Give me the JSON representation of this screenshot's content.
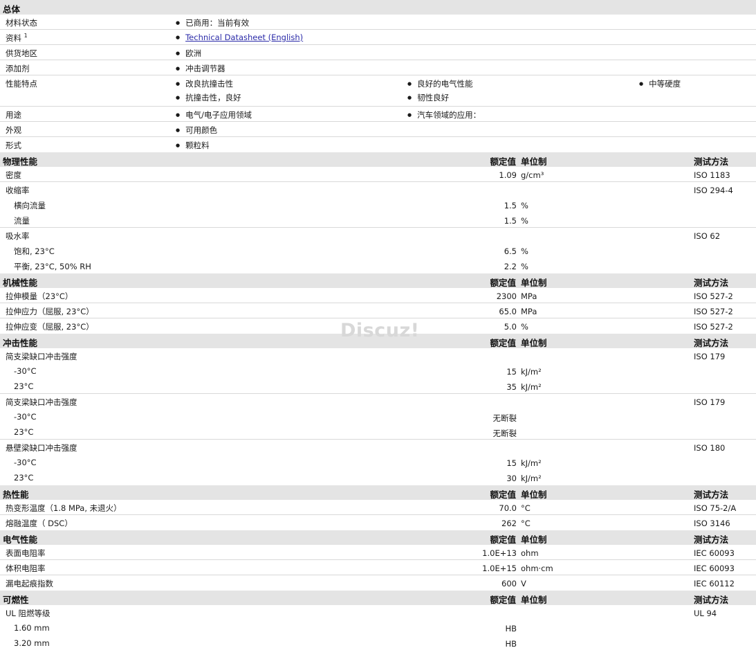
{
  "overview": {
    "title": "总体",
    "status_label": "材料状态",
    "status_value": "已商用：当前有效",
    "docs_label": "资料",
    "docs_sup": "1",
    "docs_link": "Technical Datasheet (English)",
    "region_label": "供货地区",
    "region_value": "欧洲",
    "additive_label": "添加剂",
    "additive_value": "冲击调节器",
    "features_label": "性能特点",
    "features": [
      "改良抗撞击性",
      "良好的电气性能",
      "中等硬度",
      "抗撞击性，良好",
      "韧性良好"
    ],
    "uses_label": "用途",
    "uses": [
      "电气/电子应用领域",
      "汽车领域的应用："
    ],
    "appearance_label": "外观",
    "appearance_value": "可用颜色",
    "form_label": "形式",
    "form_value": "颗粒料"
  },
  "col_headers": {
    "rated": "额定值",
    "unit": "单位制",
    "method": "测试方法"
  },
  "physical": {
    "title": "物理性能",
    "density": {
      "label": "密度",
      "value": "1.09",
      "unit": "g/cm³",
      "method": "ISO 1183"
    },
    "shrink": {
      "label": "收缩率",
      "method": "ISO 294-4"
    },
    "shrink_trans": {
      "label": "横向流量",
      "value": "1.5",
      "unit": "%"
    },
    "shrink_flow": {
      "label": "流量",
      "value": "1.5",
      "unit": "%"
    },
    "water": {
      "label": "吸水率",
      "method": "ISO 62"
    },
    "water_sat": {
      "label": "饱和, 23°C",
      "value": "6.5",
      "unit": "%"
    },
    "water_eq": {
      "label": "平衡, 23°C, 50% RH",
      "value": "2.2",
      "unit": "%"
    }
  },
  "mechanical": {
    "title": "机械性能",
    "modulus": {
      "label": "拉伸模量（23°C）",
      "value": "2300",
      "unit": "MPa",
      "method": "ISO 527-2"
    },
    "stress": {
      "label": "拉伸应力（屈服, 23°C）",
      "value": "65.0",
      "unit": "MPa",
      "method": "ISO 527-2"
    },
    "strain": {
      "label": "拉伸应变（屈服, 23°C）",
      "value": "5.0",
      "unit": "%",
      "method": "ISO 527-2"
    }
  },
  "impact": {
    "title": "冲击性能",
    "charpy_notched": {
      "label": "简支梁缺口冲击强度",
      "method": "ISO 179"
    },
    "cn_m30": {
      "label": "-30°C",
      "value": "15",
      "unit": "kJ/m²"
    },
    "cn_23": {
      "label": "23°C",
      "value": "35",
      "unit": "kJ/m²"
    },
    "charpy_unnotched": {
      "label": "简支梁缺口冲击强度",
      "method": "ISO 179"
    },
    "cu_m30": {
      "label": "-30°C",
      "value": "无断裂"
    },
    "cu_23": {
      "label": "23°C",
      "value": "无断裂"
    },
    "izod": {
      "label": "悬壁梁缺口冲击强度",
      "method": "ISO 180"
    },
    "iz_m30": {
      "label": "-30°C",
      "value": "15",
      "unit": "kJ/m²"
    },
    "iz_23": {
      "label": "23°C",
      "value": "30",
      "unit": "kJ/m²"
    }
  },
  "thermal": {
    "title": "热性能",
    "hdt": {
      "label": "热变形温度（1.8 MPa, 未退火）",
      "value": "70.0",
      "unit": "°C",
      "method": "ISO 75-2/A"
    },
    "melt": {
      "label": "熔融温度（ DSC）",
      "value": "262",
      "unit": "°C",
      "method": "ISO 3146"
    }
  },
  "electrical": {
    "title": "电气性能",
    "surface": {
      "label": "表面电阻率",
      "value": "1.0E+13",
      "unit": "ohm",
      "method": "IEC 60093"
    },
    "volume": {
      "label": "体积电阻率",
      "value": "1.0E+15",
      "unit": "ohm·cm",
      "method": "IEC 60093"
    },
    "cti": {
      "label": "漏电起痕指数",
      "value": "600",
      "unit": "V",
      "method": "IEC 60112"
    }
  },
  "flammability": {
    "title": "可燃性",
    "ul": {
      "label": "UL 阻燃等级",
      "method": "UL 94"
    },
    "ul_160": {
      "label": "1.60 mm",
      "value": "HB"
    },
    "ul_320": {
      "label": "3.20 mm",
      "value": "HB"
    }
  },
  "watermark": "Discuz!"
}
